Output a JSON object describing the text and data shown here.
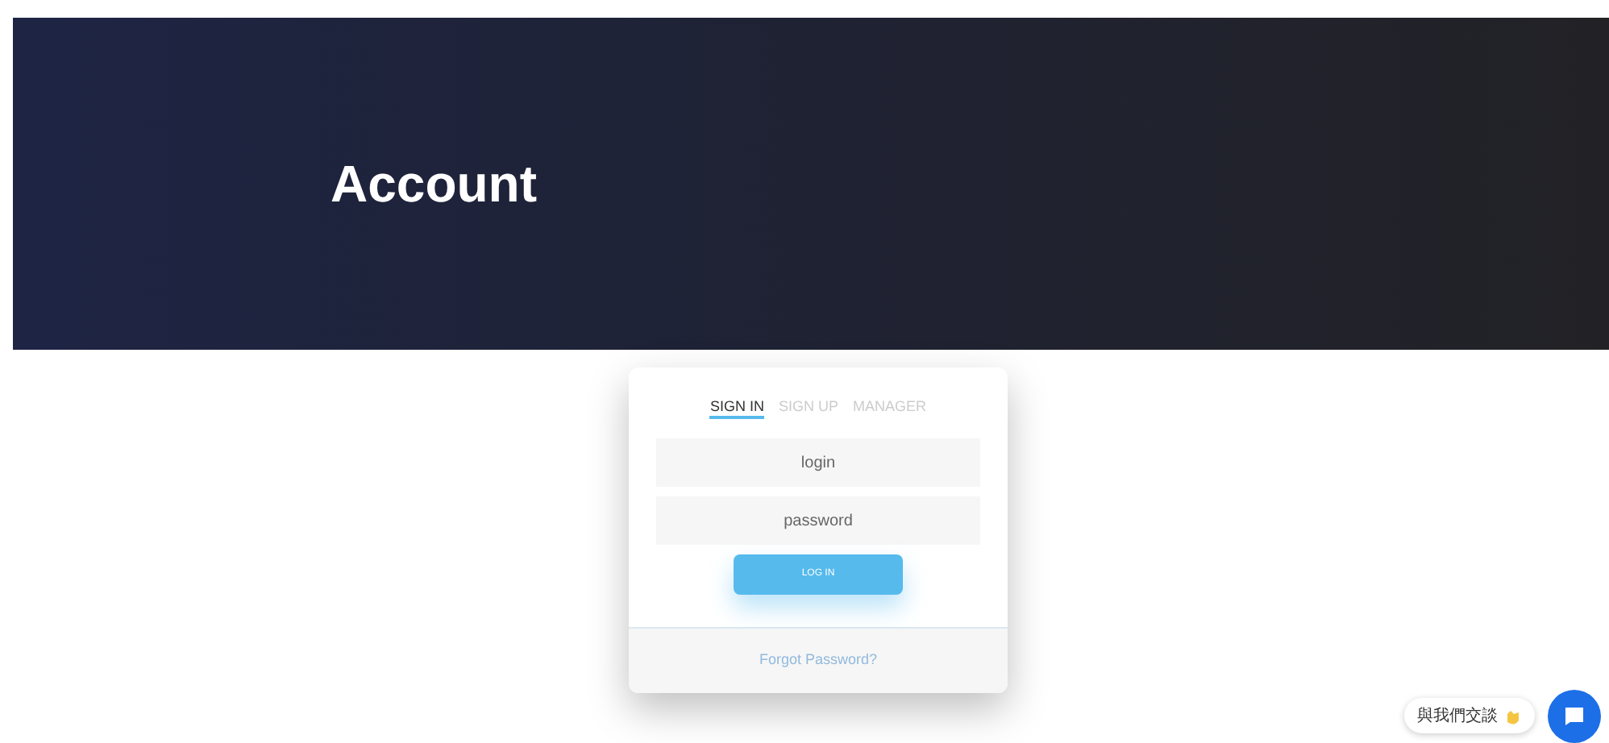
{
  "header": {
    "title": "Account"
  },
  "tabs": [
    {
      "label": "SIGN IN",
      "selected": true
    },
    {
      "label": "SIGN UP",
      "selected": false
    },
    {
      "label": "MANAGER",
      "selected": false
    }
  ],
  "fields": [
    {
      "placeholder": "login"
    },
    {
      "placeholder": "password"
    }
  ],
  "login_button": "LOG IN",
  "forgot_link": "Forgot Password?",
  "chat": {
    "label": "與我們交談"
  }
}
